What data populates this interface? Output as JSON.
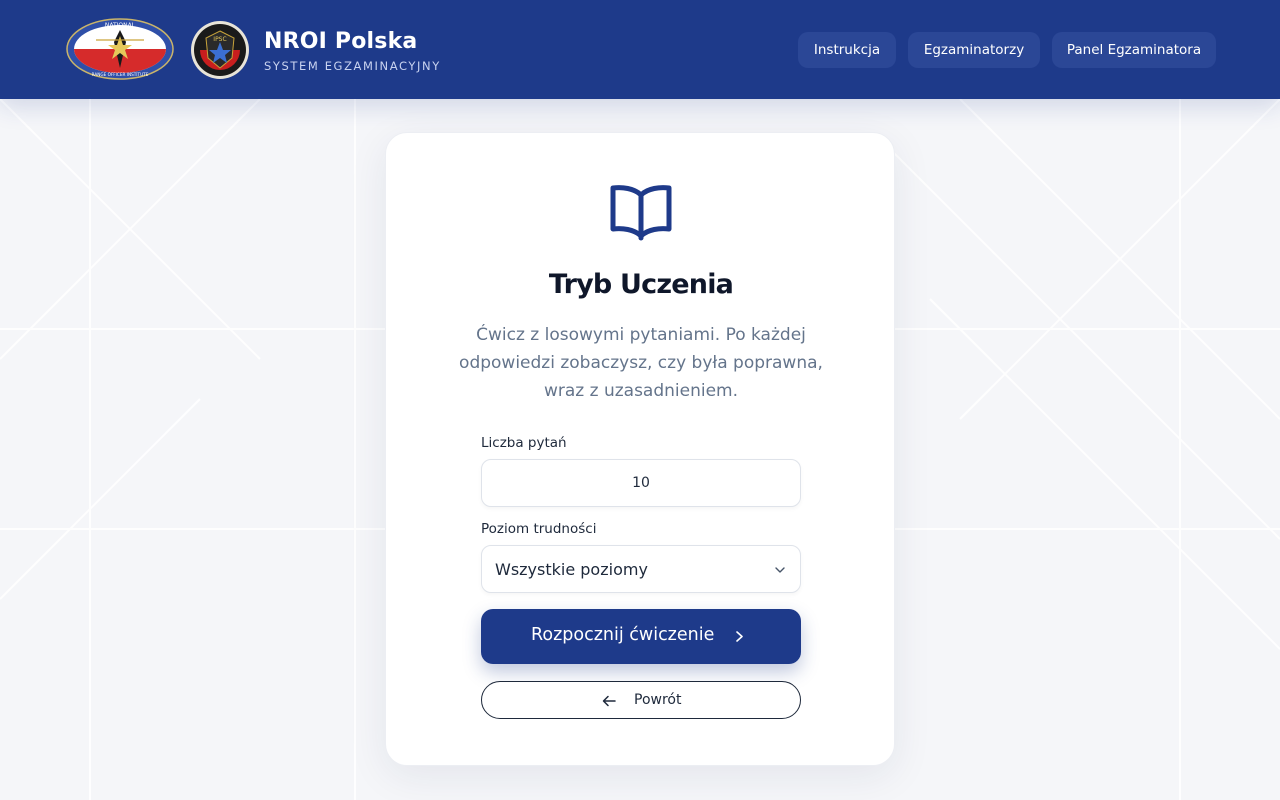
{
  "brand": {
    "title": "NROI Polska",
    "subtitle": "SYSTEM EGZAMINACYJNY",
    "logo_nroi_text_top": "NATIONAL",
    "logo_nroi_text_bottom": "RANGE OFFICER INSTITUTE",
    "logo_ipsc_text": "IPSC"
  },
  "nav": {
    "items": [
      {
        "label": "Instrukcja"
      },
      {
        "label": "Egzaminatorzy"
      },
      {
        "label": "Panel Egzaminatora"
      }
    ]
  },
  "card": {
    "icon": "book-open-icon",
    "title": "Tryb Uczenia",
    "description": "Ćwicz z losowymi pytaniami. Po każdej odpowiedzi zobaczysz, czy była poprawna, wraz z uzasadnieniem."
  },
  "form": {
    "count_label": "Liczba pytań",
    "count_value": "10",
    "level_label": "Poziom trudności",
    "level_value": "Wszystkie poziomy",
    "start_label": "Rozpocznij ćwiczenie",
    "back_label": "Powrót"
  },
  "colors": {
    "primary": "#1e3a8a",
    "nav_button": "#2b4796",
    "text_dark": "#0f172a",
    "text_muted": "#64748b",
    "background": "#f5f6f9"
  }
}
